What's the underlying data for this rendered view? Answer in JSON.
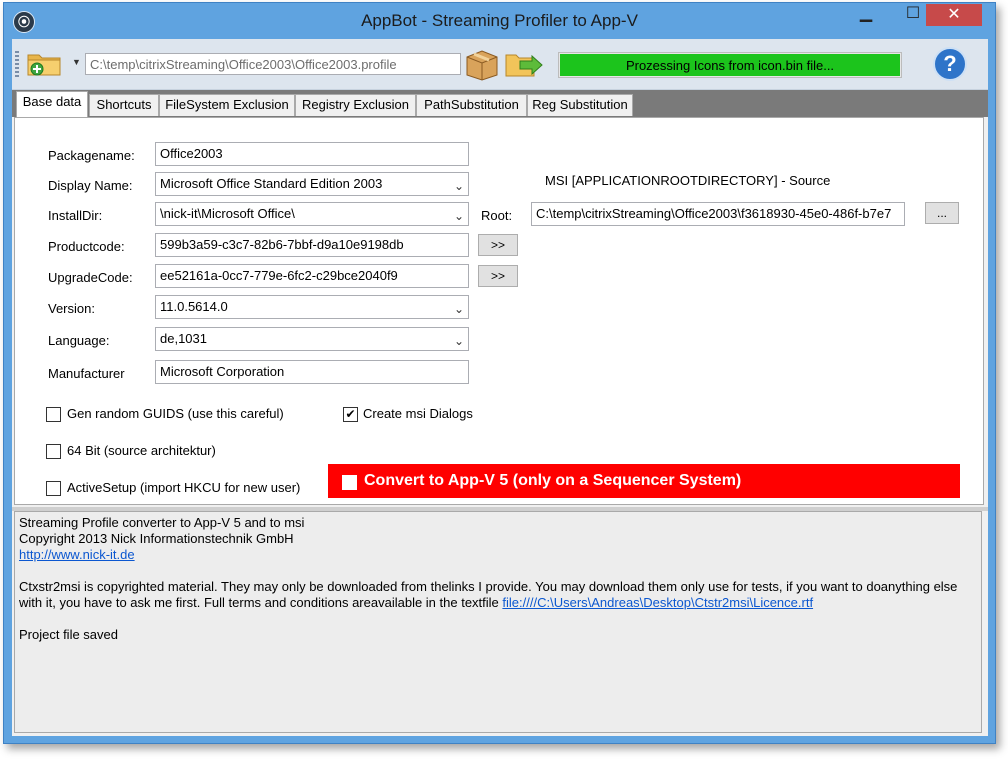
{
  "window": {
    "title": "AppBot - Streaming Profiler to App-V"
  },
  "toolbar": {
    "profile_path": "C:\\temp\\citrixStreaming\\Office2003\\Office2003.profile",
    "progress_text": "Prozessing Icons from icon.bin file...",
    "progress_fraction": 1.0,
    "progress_color": "#1cc41c",
    "icons": [
      "add-profile-folder-icon",
      "dropdown-arrow-icon",
      "package-box-icon",
      "export-arrow-icon",
      "help-icon"
    ]
  },
  "tabs": [
    {
      "label": "Base data",
      "active": true
    },
    {
      "label": "Shortcuts",
      "active": false
    },
    {
      "label": "FileSystem Exclusion",
      "active": false
    },
    {
      "label": "Registry Exclusion",
      "active": false
    },
    {
      "label": "PathSubstitution",
      "active": false
    },
    {
      "label": "Reg Substitution",
      "active": false
    }
  ],
  "form": {
    "packagename": {
      "label": "Packagename:",
      "value": "Office2003"
    },
    "display_name": {
      "label": "Display Name:",
      "value": "Microsoft Office Standard Edition 2003"
    },
    "install_dir": {
      "label": "InstallDir:",
      "value": "\\nick-it\\Microsoft Office\\"
    },
    "productcode": {
      "label": "Productcode:",
      "value": "599b3a59-c3c7-82b6-7bbf-d9a10e9198db"
    },
    "upgradecode": {
      "label": "UpgradeCode:",
      "value": "ee52161a-0cc7-779e-6fc2-c29bce2040f9"
    },
    "version": {
      "label": "Version:",
      "value": "11.0.5614.0"
    },
    "language": {
      "label": "Language:",
      "value": "de,1031"
    },
    "manufacturer": {
      "label": "Manufacturer",
      "value": "Microsoft Corporation"
    },
    "generate_button": ">>",
    "msi_source_label": "MSI [APPLICATIONROOTDIRECTORY] - Source",
    "root_label": "Root:",
    "root_value": "C:\\temp\\citrixStreaming\\Office2003\\f3618930-45e0-486f-b7e7",
    "browse_button": "...",
    "options": {
      "gen_random_guids": {
        "label": "Gen random GUIDS (use this careful)",
        "checked": false
      },
      "create_msi_dialogs": {
        "label": "Create msi Dialogs",
        "checked": true
      },
      "bit64": {
        "label": "64 Bit (source architektur)",
        "checked": false
      },
      "active_setup": {
        "label": "ActiveSetup (import HKCU for new user)",
        "checked": false
      }
    },
    "convert": {
      "label": "Convert to App-V 5 (only on a Sequencer System)",
      "checked": false,
      "color": "#ff0000"
    }
  },
  "log": {
    "line1": "Streaming Profile converter to App-V 5 and to msi",
    "line2": "Copyright 2013 Nick Informationstechnik GmbH",
    "link1": "http://www.nick-it.de",
    "notice": "Ctxstr2msi is copyrighted material. They may only be downloaded from thelinks I provide.  You may download them only use for tests, if you want to doanything else with it, you have to ask me first.  Full terms and conditions areavailable in the textfile ",
    "licence_link": "file:////C:\\Users\\Andreas\\Desktop\\Ctstr2msi\\Licence.rtf",
    "status": "Project file saved"
  }
}
